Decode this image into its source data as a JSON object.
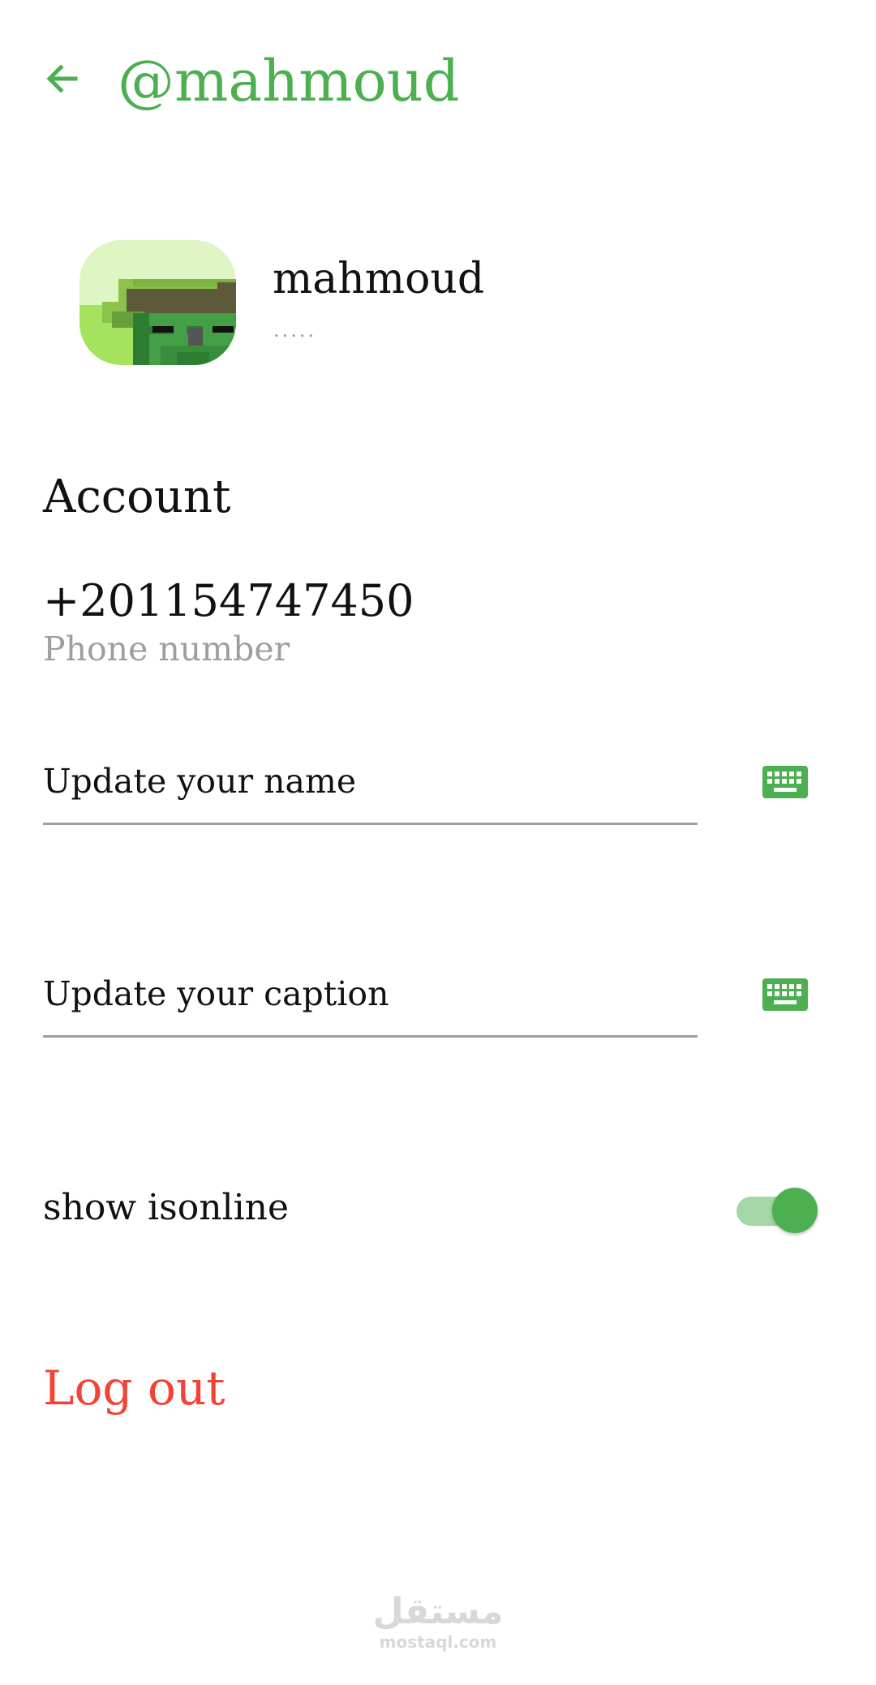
{
  "header": {
    "back_icon": "arrow-left-icon",
    "title": "@mahmoud",
    "accent_color": "#4CAF50"
  },
  "profile": {
    "avatar_icon": "pixel-avatar",
    "name": "mahmoud",
    "caption": "....."
  },
  "account": {
    "section_title": "Account",
    "phone_value": "+201154747450",
    "phone_label": "Phone number"
  },
  "form": {
    "name_placeholder": "Update your name",
    "caption_placeholder": "Update your caption",
    "keyboard_icon": "keyboard-icon"
  },
  "settings": {
    "show_online_label": "show isonline",
    "show_online_enabled": true
  },
  "actions": {
    "logout_label": "Log out",
    "logout_color": "#F44336"
  },
  "watermark": {
    "text": "مستقل",
    "domain": "mostaql.com"
  }
}
